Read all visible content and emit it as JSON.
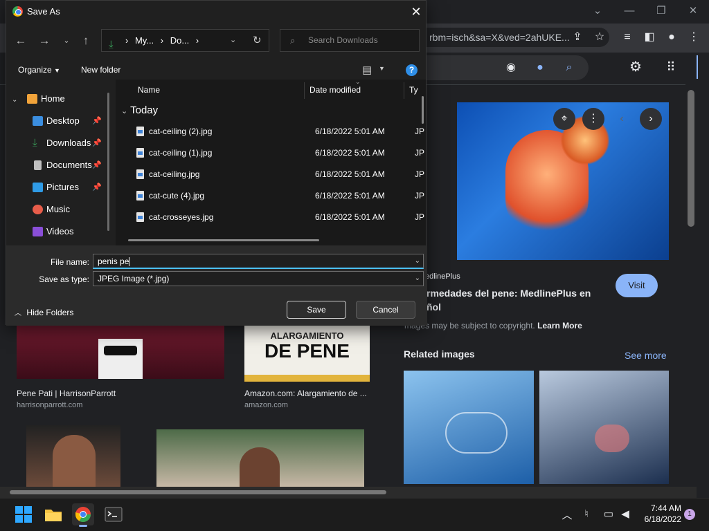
{
  "chrome": {
    "url_fragment": "rbm=isch&sa=X&ved=2ahUKE...",
    "window_controls": {
      "min": "⌄",
      "minimize": "—",
      "restore": "❐",
      "close": "✕"
    }
  },
  "preview": {
    "source": "edlinePlus",
    "title_line1": "rmedades del pene: MedlinePlus en",
    "title_line2": "ñol",
    "visit_label": "Visit",
    "copyright_text": "mages may be subject to copyright.",
    "learn_more": "Learn More",
    "related_heading": "Related images",
    "see_more": "See more"
  },
  "results": [
    {
      "title": "Pene Pati | HarrisonParrott",
      "site": "harrisonparrott.com"
    },
    {
      "title": "Amazon.com: Alargamiento de ...",
      "site": "amazon.com",
      "book_line1": "ALARGAMIENTO",
      "book_line2": "DE PENE"
    }
  ],
  "dialog": {
    "title": "Save As",
    "address": {
      "seg1": "My...",
      "seg2": "Do...",
      "sep": "›"
    },
    "search_placeholder": "Search Downloads",
    "commands": {
      "organize": "Organize",
      "new_folder": "New folder",
      "help": "?"
    },
    "nav_items": [
      {
        "label": "Home",
        "pinned": false
      },
      {
        "label": "Desktop",
        "pinned": true
      },
      {
        "label": "Downloads",
        "pinned": true
      },
      {
        "label": "Documents",
        "pinned": true
      },
      {
        "label": "Pictures",
        "pinned": true
      },
      {
        "label": "Music",
        "pinned": false
      },
      {
        "label": "Videos",
        "pinned": false
      }
    ],
    "columns": {
      "name": "Name",
      "date": "Date modified",
      "type": "Ty"
    },
    "group": "Today",
    "files": [
      {
        "name": "cat-ceiling (2).jpg",
        "date": "6/18/2022 5:01 AM",
        "type": "JP"
      },
      {
        "name": "cat-ceiling (1).jpg",
        "date": "6/18/2022 5:01 AM",
        "type": "JP"
      },
      {
        "name": "cat-ceiling.jpg",
        "date": "6/18/2022 5:01 AM",
        "type": "JP"
      },
      {
        "name": "cat-cute (4).jpg",
        "date": "6/18/2022 5:01 AM",
        "type": "JP"
      },
      {
        "name": "cat-crosseyes.jpg",
        "date": "6/18/2022 5:01 AM",
        "type": "JP"
      }
    ],
    "filename_label": "File name:",
    "filename_value": "penis pe",
    "savetype_label": "Save as type:",
    "savetype_value": "JPEG Image (*.jpg)",
    "hide_folders": "Hide Folders",
    "save_label": "Save",
    "cancel_label": "Cancel"
  },
  "taskbar": {
    "time": "7:44 AM",
    "date": "6/18/2022",
    "notification_count": "1"
  },
  "colors": {
    "accent": "#4cc2ff",
    "visit_button": "#8ab4f8",
    "link": "#8ab4f8"
  }
}
